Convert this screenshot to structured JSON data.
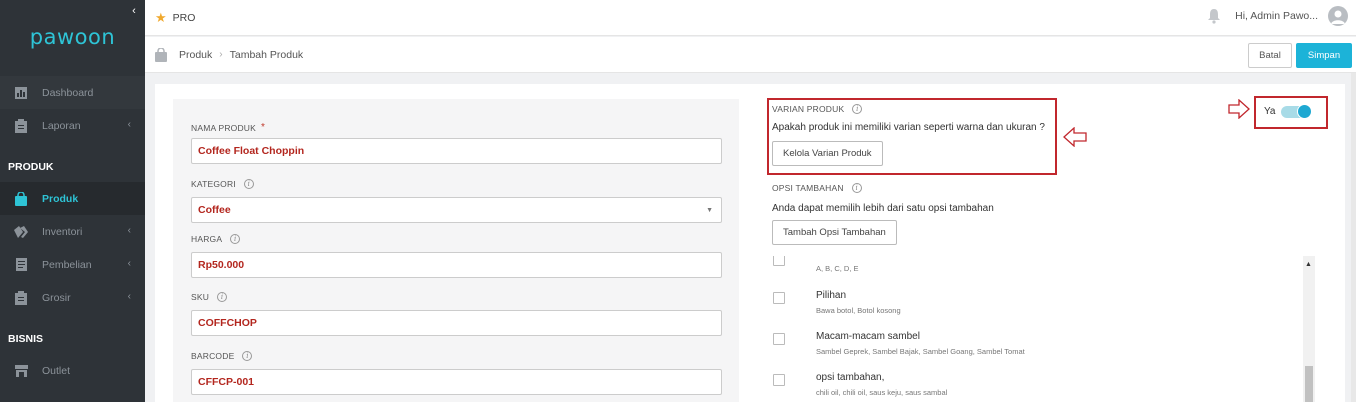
{
  "sidebar": {
    "logo": "pawoon",
    "collapse_glyph": "‹",
    "items": [
      {
        "label": "Dashboard",
        "icon": "bar-chart-icon"
      },
      {
        "label": "Laporan",
        "icon": "clipboard-icon"
      },
      {
        "label": "Produk",
        "icon": "shopping-bag-icon"
      },
      {
        "label": "Inventori",
        "icon": "tags-icon"
      },
      {
        "label": "Pembelian",
        "icon": "document-icon"
      },
      {
        "label": "Grosir",
        "icon": "clipboard-icon"
      },
      {
        "label": "Outlet",
        "icon": "store-icon"
      }
    ],
    "sections": [
      "PRODUK",
      "BISNIS"
    ]
  },
  "topbar": {
    "plan": "PRO",
    "greeting": "Hi, Admin Pawo..."
  },
  "breadcrumb": {
    "items": [
      "Produk",
      "Tambah Produk"
    ],
    "separator": "›"
  },
  "actions": {
    "cancel": "Batal",
    "save": "Simpan"
  },
  "form": {
    "name_label": "NAMA PRODUK",
    "required_mark": "*",
    "name_value": "Coffee Float Choppin",
    "category_label": "KATEGORI",
    "category_value": "Coffee",
    "price_label": "HARGA",
    "price_value": "Rp50.000",
    "sku_label": "SKU",
    "sku_value": "COFFCHOP",
    "barcode_label": "BARCODE",
    "barcode_value": "CFFCP-001"
  },
  "variant": {
    "title": "VARIAN PRODUK",
    "question": "Apakah produk ini memiliki varian seperti warna dan ukuran ?",
    "button": "Kelola Varian Produk",
    "toggle_label": "Ya",
    "toggle_on": true
  },
  "addons": {
    "title": "OPSI TAMBAHAN",
    "desc": "Anda dapat memilih lebih dari satu opsi tambahan",
    "button": "Tambah Opsi Tambahan",
    "options": [
      {
        "name": "",
        "sub": "A, B, C, D, E"
      },
      {
        "name": "Pilihan",
        "sub": "Bawa botol, Botol kosong"
      },
      {
        "name": "Macam-macam sambel",
        "sub": "Sambel Geprek, Sambel Bajak, Sambel Goang, Sambel Tomat"
      },
      {
        "name": "opsi tambahan,",
        "sub": "chili oil, chili oil, saus keju, saus sambal"
      }
    ]
  },
  "colors": {
    "accent": "#1cb3d8",
    "sidebar": "#2e3338",
    "highlight": "#c1272d",
    "value_text": "#b3261e"
  }
}
